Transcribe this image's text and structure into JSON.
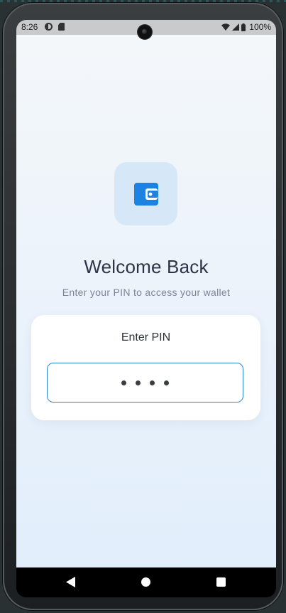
{
  "status_bar": {
    "time": "8:26",
    "battery_percent": "100%",
    "icons": [
      "data-saver-icon",
      "sim-card-icon",
      "wifi-icon",
      "signal-icon",
      "battery-icon"
    ]
  },
  "app": {
    "logo_icon": "wallet-icon",
    "title": "Welcome Back",
    "subtitle": "Enter your PIN to access your wallet",
    "pin_card": {
      "label": "Enter PIN",
      "pin_value_masked": "••••",
      "pin_length": 4
    }
  },
  "nav_bar": {
    "buttons": [
      "back",
      "home",
      "recents"
    ]
  },
  "colors": {
    "accent": "#2a86d9",
    "logo_tile_bg": "#d6e7f8",
    "title_text": "#2d3446",
    "subtitle_text": "#7b8594"
  }
}
